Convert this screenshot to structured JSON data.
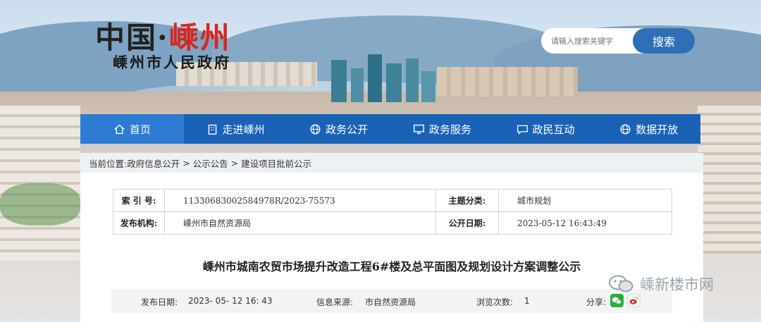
{
  "header": {
    "logo_main": "中国·",
    "logo_city": "嵊州",
    "logo_sub": "嵊州市人民政府"
  },
  "search": {
    "placeholder": "请输入搜索关键字",
    "button_label": "搜索"
  },
  "nav": {
    "items": [
      {
        "label": "首页",
        "icon": "home-icon"
      },
      {
        "label": "走进嵊州",
        "icon": "building-icon"
      },
      {
        "label": "政务公开",
        "icon": "globe-icon"
      },
      {
        "label": "政务服务",
        "icon": "monitor-icon"
      },
      {
        "label": "政民互动",
        "icon": "chat-icon"
      },
      {
        "label": "数据开放",
        "icon": "globe-icon"
      }
    ]
  },
  "breadcrumb": {
    "prefix": "当前位置:",
    "items": [
      "政府信息公开",
      "公示公告",
      "建设项目批前公示"
    ],
    "separator": " > "
  },
  "meta": {
    "index_label": "索 引 号:",
    "index_value": "11330683002584978R/2023-75573",
    "topic_label": "主题分类:",
    "topic_value": "城市规划",
    "publisher_label": "发布机构:",
    "publisher_value": "嵊州市自然资源局",
    "date_label": "公开日期:",
    "date_value": "2023-05-12 16:43:49"
  },
  "article": {
    "title": "嵊州市城南农贸市场提升改造工程6#楼及总平面图及规划设计方案调整公示"
  },
  "info_bar": {
    "publish_label": "发布日期:",
    "publish_value": "2023- 05- 12 16: 43",
    "source_label": "信息来源:",
    "source_value": "市自然资源局",
    "views_label": "浏览次数:",
    "views_value": "1",
    "share_label": "分享:"
  },
  "watermark": {
    "text": "嵊新楼市网"
  },
  "colors": {
    "nav_bg": "#1a62b6",
    "nav_active": "#2d7bd2",
    "search_button": "#2f6fb8",
    "logo_red": "#d8261f"
  }
}
